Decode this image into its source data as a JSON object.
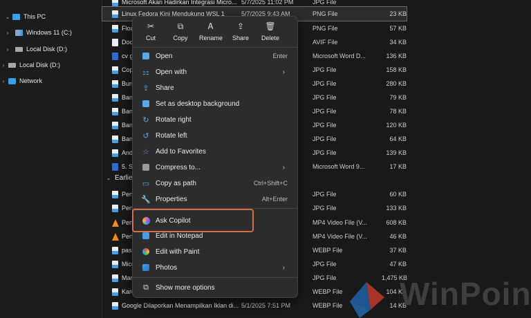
{
  "nav": {
    "items": [
      {
        "label": "This PC",
        "icon": "pc-icon"
      },
      {
        "label": "Windows 11 (C:)",
        "icon": "windows-drive-icon"
      },
      {
        "label": "Local Disk (D:)",
        "icon": "disk-icon"
      },
      {
        "label": "Local Disk (D:)",
        "icon": "disk-icon"
      },
      {
        "label": "Network",
        "icon": "network-icon"
      }
    ]
  },
  "files": {
    "rows": [
      {
        "name": "Microsoft Akan Hadirkan Integrasi Micro...",
        "date": "5/7/2025 11:02 PM",
        "type": "JPG File",
        "size": "",
        "kind": "img"
      },
      {
        "name": "Linux Fedora Kini Mendukung WSL 1",
        "date": "5/7/2025 9:43 AM",
        "type": "PNG File",
        "size": "23 KB",
        "kind": "img"
      },
      {
        "name": "Float",
        "date": "",
        "type": "PNG File",
        "size": "57 KB",
        "kind": "img"
      },
      {
        "name": "Dock",
        "date": "",
        "type": "AVIF File",
        "size": "34 KB",
        "kind": "doc"
      },
      {
        "name": "cv g",
        "date": "",
        "type": "Microsoft Word D...",
        "size": "136 KB",
        "kind": "word"
      },
      {
        "name": "Copi",
        "date": "",
        "type": "JPG File",
        "size": "158 KB",
        "kind": "img"
      },
      {
        "name": "Buru",
        "date": "",
        "type": "JPG File",
        "size": "280 KB",
        "kind": "img"
      },
      {
        "name": "Bany",
        "date": "",
        "type": "JPG File",
        "size": "79 KB",
        "kind": "img"
      },
      {
        "name": "Bany",
        "date": "",
        "type": "JPG File",
        "size": "78 KB",
        "kind": "img"
      },
      {
        "name": "Bany",
        "date": "",
        "type": "JPG File",
        "size": "120 KB",
        "kind": "img"
      },
      {
        "name": "Bany",
        "date": "",
        "type": "JPG File",
        "size": "64 KB",
        "kind": "img"
      },
      {
        "name": "Andr",
        "date": "",
        "type": "JPG File",
        "size": "139 KB",
        "kind": "img"
      },
      {
        "name": "5. Su",
        "date": "",
        "type": "Microsoft Word 9...",
        "size": "17 KB",
        "kind": "word"
      }
    ],
    "group_label": "Earlier",
    "rows2": [
      {
        "name": "Perfo",
        "date": "",
        "type": "JPG File",
        "size": "60 KB",
        "kind": "img"
      },
      {
        "name": "Perfo",
        "date": "",
        "type": "JPG File",
        "size": "133 KB",
        "kind": "img"
      },
      {
        "name": "Perfo",
        "date": "",
        "type": "MP4 Video File (V...",
        "size": "608 KB",
        "kind": "vid"
      },
      {
        "name": "Perfo",
        "date": "",
        "type": "MP4 Video File (V...",
        "size": "46 KB",
        "kind": "vid"
      },
      {
        "name": "pass",
        "date": "",
        "type": "WEBP File",
        "size": "37 KB",
        "kind": "img"
      },
      {
        "name": "Micr",
        "date": "",
        "type": "JPG File",
        "size": "47 KB",
        "kind": "img"
      },
      {
        "name": "Mani",
        "date": "",
        "type": "JPG File",
        "size": "1,475 KB",
        "kind": "img"
      },
      {
        "name": "Kare",
        "date": "",
        "type": "WEBP File",
        "size": "104 KB",
        "kind": "img"
      },
      {
        "name": "Google Dilaporkan Menampilkan Iklan di...",
        "date": "5/1/2025 7:51 PM",
        "type": "WEBP File",
        "size": "14 KB",
        "kind": "img"
      }
    ]
  },
  "menu": {
    "quick": [
      {
        "label": "Cut",
        "icon": "scissors-icon"
      },
      {
        "label": "Copy",
        "icon": "copy-icon"
      },
      {
        "label": "Rename",
        "icon": "rename-icon"
      },
      {
        "label": "Share",
        "icon": "share-icon"
      },
      {
        "label": "Delete",
        "icon": "trash-icon"
      }
    ],
    "items": [
      {
        "label": "Open",
        "shortcut": "Enter",
        "icon": "open-icon",
        "submenu": false
      },
      {
        "label": "Open with",
        "shortcut": "",
        "icon": "open-with-icon",
        "submenu": true
      },
      {
        "label": "Share",
        "shortcut": "",
        "icon": "share-icon",
        "submenu": false
      },
      {
        "label": "Set as desktop background",
        "shortcut": "",
        "icon": "desktop-background-icon",
        "submenu": false
      },
      {
        "label": "Rotate right",
        "shortcut": "",
        "icon": "rotate-right-icon",
        "submenu": false
      },
      {
        "label": "Rotate left",
        "shortcut": "",
        "icon": "rotate-left-icon",
        "submenu": false
      },
      {
        "label": "Add to Favorites",
        "shortcut": "",
        "icon": "star-icon",
        "submenu": false
      },
      {
        "label": "Compress to...",
        "shortcut": "",
        "icon": "compress-icon",
        "submenu": true
      },
      {
        "label": "Copy as path",
        "shortcut": "Ctrl+Shift+C",
        "icon": "copy-path-icon",
        "submenu": false
      },
      {
        "label": "Properties",
        "shortcut": "Alt+Enter",
        "icon": "properties-icon",
        "submenu": false
      }
    ],
    "copilot": {
      "label": "Ask Copilot",
      "icon": "copilot-icon"
    },
    "apps": [
      {
        "label": "Edit in Notepad",
        "icon": "notepad-icon",
        "submenu": false
      },
      {
        "label": "Edit with Paint",
        "icon": "paint-icon",
        "submenu": false
      },
      {
        "label": "Photos",
        "icon": "photos-icon",
        "submenu": true
      }
    ],
    "more": {
      "label": "Show more options",
      "icon": "more-options-icon"
    }
  },
  "watermark": {
    "text": "WinPoin"
  },
  "colors": {
    "accent": "#5aa8ec",
    "highlight": "#d0704a",
    "menu_bg": "#2c2c2c",
    "window_bg": "#191919"
  }
}
